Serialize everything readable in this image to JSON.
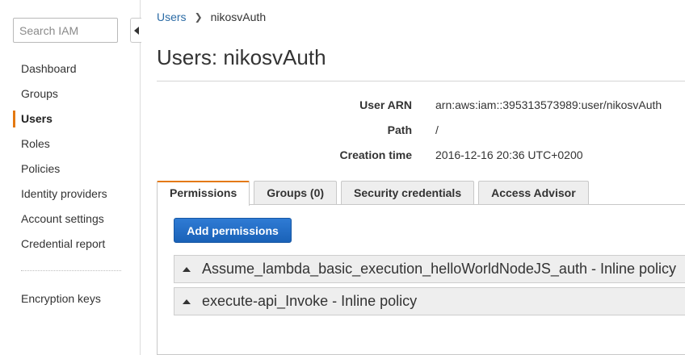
{
  "sidebar": {
    "search_placeholder": "Search IAM",
    "items": [
      {
        "label": "Dashboard"
      },
      {
        "label": "Groups"
      },
      {
        "label": "Users"
      },
      {
        "label": "Roles"
      },
      {
        "label": "Policies"
      },
      {
        "label": "Identity providers"
      },
      {
        "label": "Account settings"
      },
      {
        "label": "Credential report"
      }
    ],
    "active_item": "Users",
    "secondary_items": [
      {
        "label": "Encryption keys"
      }
    ],
    "accent_color": "#e47911"
  },
  "breadcrumb": {
    "parent": "Users",
    "current": "nikosvAuth"
  },
  "page": {
    "title": "Users: nikosvAuth"
  },
  "summary": {
    "user_arn_label": "User ARN",
    "user_arn_value": "arn:aws:iam::395313573989:user/nikosvAuth",
    "path_label": "Path",
    "path_value": "/",
    "creation_time_label": "Creation time",
    "creation_time_value": "2016-12-16 20:36 UTC+0200"
  },
  "tabs": [
    {
      "label": "Permissions",
      "active": true
    },
    {
      "label": "Groups (0)",
      "active": false
    },
    {
      "label": "Security credentials",
      "active": false
    },
    {
      "label": "Access Advisor",
      "active": false
    }
  ],
  "permissions": {
    "add_button_label": "Add permissions",
    "button_color": "#2273d0",
    "policies": [
      {
        "name": "Assume_lambda_basic_execution_helloWorldNodeJS_auth - Inline policy"
      },
      {
        "name": "execute-api_Invoke - Inline policy"
      }
    ]
  }
}
